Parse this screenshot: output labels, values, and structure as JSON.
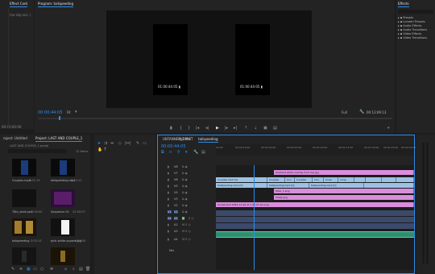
{
  "source_panel": {
    "tab_effect_controls": "Effect Cont",
    "no_clip": "(no clip sel..)",
    "timecode": "00:00:00:00"
  },
  "program": {
    "tab_program": "Program: tailspeeding",
    "tc_left_screen": "01:00:44:05 ▮",
    "tc_right_screen": "01:00:44:05 ▮",
    "playhead_tc": "00:00:44:05",
    "fit": "Fit",
    "full": "Full",
    "duration": "00:13:09:13"
  },
  "effects": {
    "tab": "Effects",
    "items": [
      "Presets",
      "Lumetri Presets",
      "Audio Effects",
      "Audio Transitions",
      "Video Effects",
      "Video Transitions"
    ]
  },
  "project": {
    "tab_left": "roject: Untitled",
    "tab_active": "Project: LAST AND COUPLE_1",
    "path": "LAST AND COUPLE_1.prproj",
    "count": "12 items",
    "items": [
      {
        "name": "Couples.mp4",
        "dur": "6:01:13",
        "kind": "portrait-blue"
      },
      {
        "name": "tailspeeding.mp4",
        "dur": "9:13:11",
        "kind": "portrait-blue"
      },
      {
        "name": "Title_start.psd",
        "dur": "5:00:00",
        "kind": "dark"
      },
      {
        "name": "Sequence 01",
        "dur": "22:00:07",
        "kind": "purple"
      },
      {
        "name": "tailspeeding",
        "dur": "3:03:13",
        "kind": "gold"
      },
      {
        "name": "pink-white-square.jpg",
        "dur": "5:00:00",
        "kind": "white"
      },
      {
        "name": "",
        "dur": "",
        "kind": "dark2"
      },
      {
        "name": "",
        "dur": "",
        "kind": "gold2"
      }
    ]
  },
  "timeline": {
    "tabs": [
      "UNTANNED_DRAFT",
      "tb5 Mai",
      "tailspeeding"
    ],
    "playhead_tc": "00:00:44:05",
    "ruler": [
      "00:00",
      "00:00:15:00",
      "00:00:30:00",
      "00:00:45:00",
      "00:01:00:00",
      "00:01:15:00",
      "00:01:30:00",
      "00:01:45:00",
      "00:02:00:00"
    ],
    "track_labels": [
      "V8",
      "V7",
      "V6",
      "V5",
      "V4",
      "V3",
      "V2",
      "V1",
      "A1",
      "A2",
      "A3",
      "A4",
      "Mix"
    ],
    "clips": {
      "v8": "Gradient white overlay from top.jpg",
      "v7_a": "Couples.mp4 [V]",
      "v7_b": "Couples",
      "v7_c": "Cou",
      "v7_d": "Couples",
      "v7_e": "Cou",
      "v7_f": "Coup",
      "v7_g": "Coup",
      "v6_a": "tailspeeding.mp4 [V]",
      "v6_b": "tailspeeding.mp4 [V]",
      "v6_c": "tailspeeding.mp4 [V]",
      "v5": "Toter_1.png",
      "v4": "Thala.png",
      "v3": "Screenshot 2025-11-20 at 1.32.37 am.png"
    }
  },
  "colors": {
    "accent": "#2d8ceb",
    "video_clip": "#9bc2e4",
    "graphic_clip": "#d98ddb",
    "audio_clip": "#2f8e6f"
  }
}
